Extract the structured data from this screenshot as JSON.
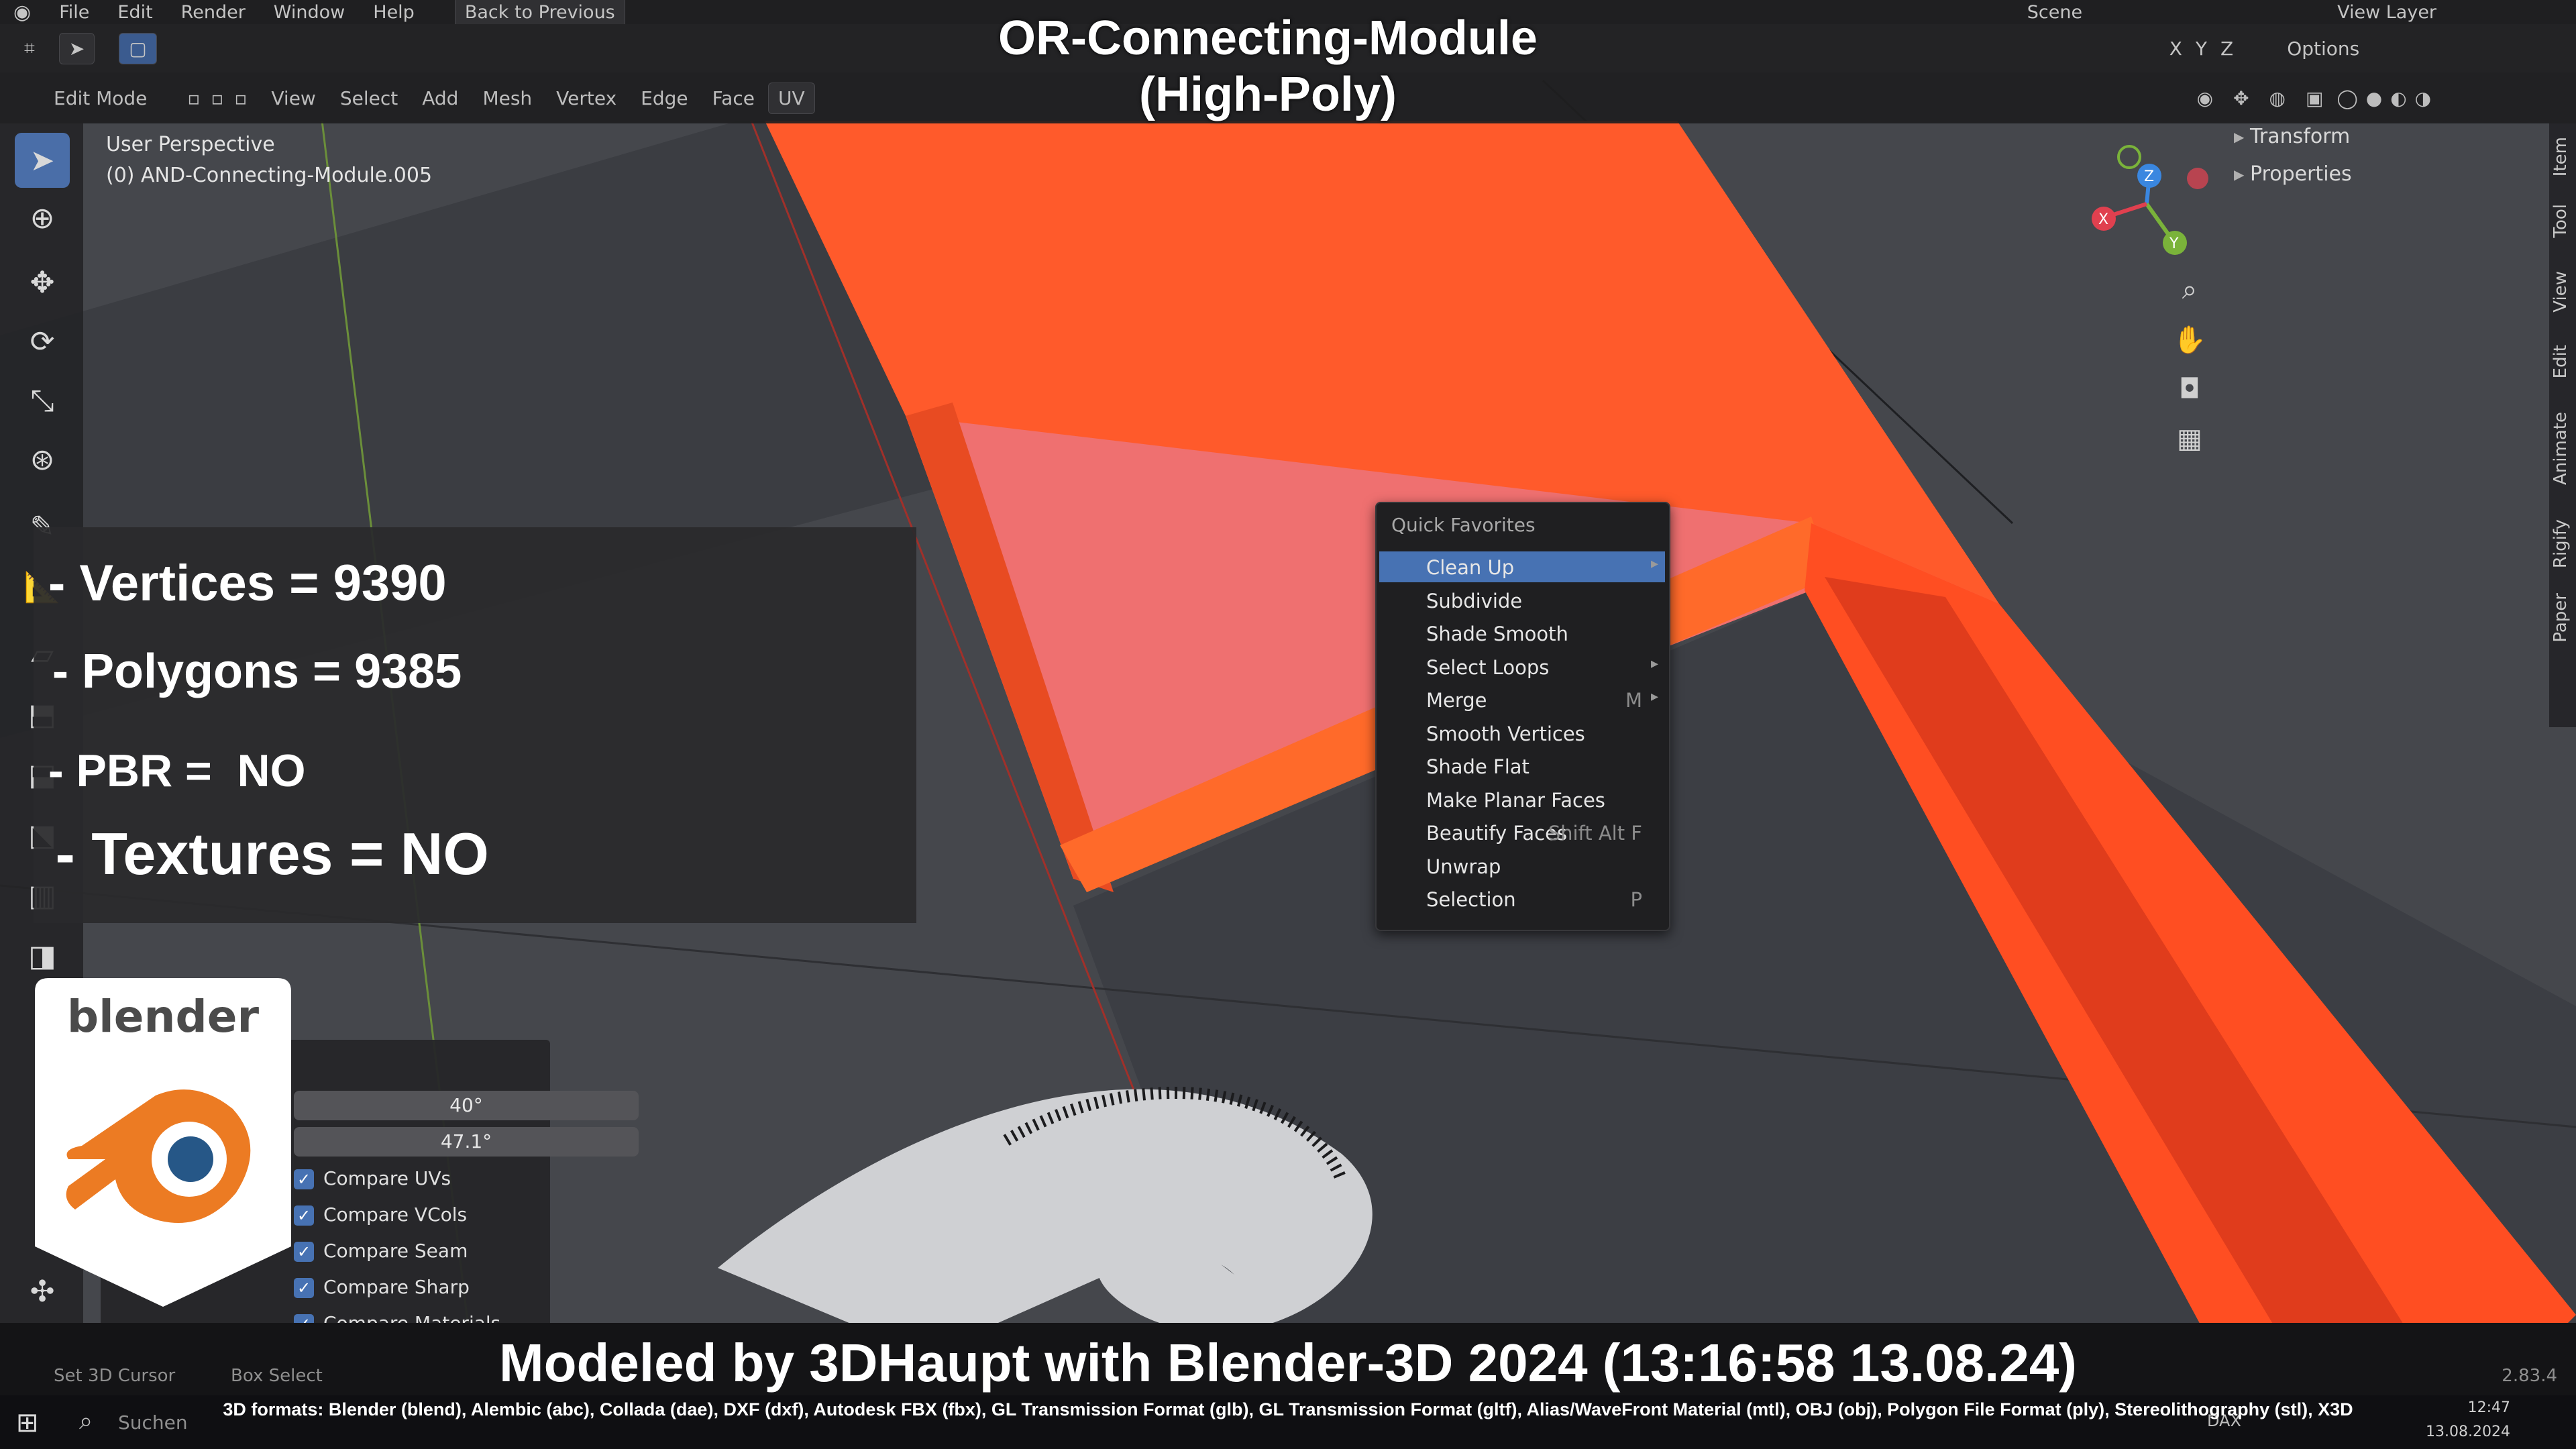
{
  "window": {
    "menu": [
      "File",
      "Edit",
      "Render",
      "Window",
      "Help"
    ],
    "back_button": "Back to Previous",
    "scene_label": "Scene",
    "view_layer_label": "View Layer",
    "options_label": "Options",
    "axis_labels": [
      "X",
      "Y",
      "Z"
    ]
  },
  "viewport_header": {
    "mode": "Edit Mode",
    "menus": [
      "View",
      "Select",
      "Add",
      "Mesh",
      "Vertex",
      "Edge",
      "Face",
      "UV"
    ]
  },
  "viewport_info": {
    "perspective": "User Perspective",
    "object": "(0) AND-Connecting-Module.005"
  },
  "overlay": {
    "title_line1": "OR-Connecting-Module",
    "title_line2": "(High-Poly)",
    "vertices": "- Vertices = 9390",
    "polygons": " - Polygons = 9385",
    "pbr": "- PBR =  NO",
    "textures": " - Textures = NO",
    "footer": "Modeled by 3DHaupt with Blender-3D 2024 (13:16:58  13.08.24)",
    "formats": "3D formats: Blender (blend), Alembic (abc), Collada (dae), DXF (dxf), Autodesk FBX (fbx), GL Transmission Format (glb), GL Transmission Format (gltf), Alias/WaveFront Material (mtl), OBJ (obj), Polygon File Format (ply), Stereolithography (stl), X3D"
  },
  "quick_favorites": {
    "title": "Quick Favorites",
    "items": [
      {
        "label": "Clean Up",
        "shortcut": "",
        "submenu": true,
        "highlighted": true
      },
      {
        "label": "Subdivide",
        "shortcut": "",
        "submenu": false
      },
      {
        "label": "Shade Smooth",
        "shortcut": "",
        "submenu": false
      },
      {
        "label": "Select Loops",
        "shortcut": "",
        "submenu": true
      },
      {
        "label": "Merge",
        "shortcut": "M",
        "submenu": true
      },
      {
        "label": "Smooth Vertices",
        "shortcut": "",
        "submenu": false
      },
      {
        "label": "Shade Flat",
        "shortcut": "",
        "submenu": false
      },
      {
        "label": "Make Planar Faces",
        "shortcut": "",
        "submenu": false
      },
      {
        "label": "Beautify Faces",
        "shortcut": "Shift Alt F",
        "submenu": false
      },
      {
        "label": "Unwrap",
        "shortcut": "",
        "submenu": false
      },
      {
        "label": "Selection",
        "shortcut": "P",
        "submenu": false
      }
    ]
  },
  "n_panel": {
    "sections": [
      "Transform",
      "Properties"
    ],
    "tabs": [
      "Item",
      "Tool",
      "View",
      "Edit",
      "Animate",
      "Rigify",
      "Paper"
    ]
  },
  "operator_panel": {
    "fields": [
      "40°",
      "47.1°"
    ],
    "checks": [
      "Compare UVs",
      "Compare VCols",
      "Compare Seam",
      "Compare Sharp",
      "Compare Materials"
    ]
  },
  "logo": {
    "text": "blender"
  },
  "status_bar": {
    "items": [
      "Set 3D Cursor",
      "Box Select"
    ],
    "version": "2.83.4"
  },
  "taskbar": {
    "search": "Suchen",
    "time": "12:47",
    "date": "13.08.2024",
    "tray": "DAX"
  },
  "colors": {
    "selection_orange": "#ff5a2b",
    "face_pink": "#f06a6a",
    "menu_highlight": "#4772b3",
    "gizmo_x": "#e0404f",
    "gizmo_y": "#7ab33a",
    "gizmo_z": "#3a87e0"
  }
}
